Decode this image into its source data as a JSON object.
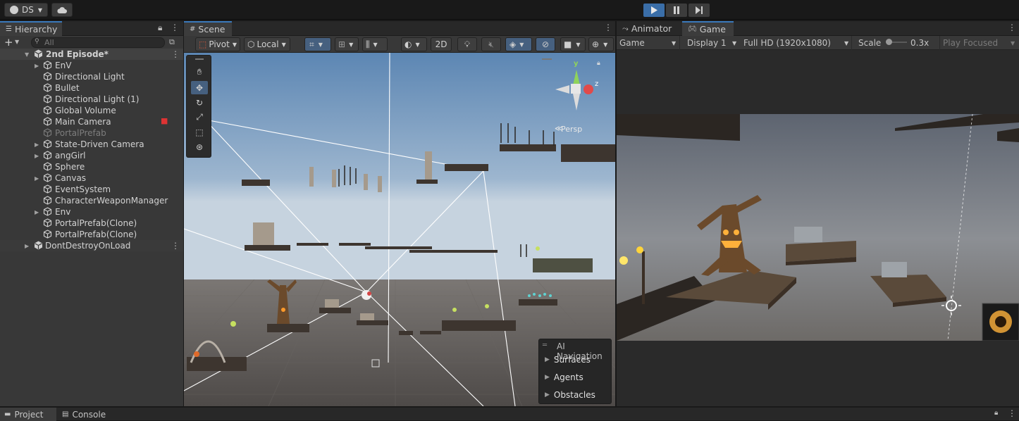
{
  "toolbar": {
    "account_label": "DS",
    "account_icon": "account-icon",
    "cloud_icon": "cloud-icon",
    "play_icon": "play-icon",
    "pause_icon": "pause-icon",
    "step_icon": "step-icon"
  },
  "hierarchy": {
    "tab_label": "Hierarchy",
    "search_placeholder": "All",
    "scene_name": "2nd Episode*",
    "items": [
      {
        "label": "EnV",
        "expandable": true,
        "dimmed": false
      },
      {
        "label": "Directional Light",
        "expandable": false,
        "dimmed": false
      },
      {
        "label": "Bullet",
        "expandable": false,
        "dimmed": false
      },
      {
        "label": "Directional Light (1)",
        "expandable": false,
        "dimmed": false
      },
      {
        "label": "Global Volume",
        "expandable": false,
        "dimmed": false
      },
      {
        "label": "Main Camera",
        "expandable": false,
        "dimmed": false
      },
      {
        "label": "PortalPrefab",
        "expandable": false,
        "dimmed": true
      },
      {
        "label": "State-Driven Camera",
        "expandable": true,
        "dimmed": false
      },
      {
        "label": "angGirl",
        "expandable": true,
        "dimmed": false
      },
      {
        "label": "Sphere",
        "expandable": false,
        "dimmed": false
      },
      {
        "label": "Canvas",
        "expandable": true,
        "dimmed": false
      },
      {
        "label": "EventSystem",
        "expandable": false,
        "dimmed": false
      },
      {
        "label": "CharacterWeaponManager",
        "expandable": false,
        "dimmed": false
      },
      {
        "label": "Env",
        "expandable": true,
        "dimmed": false
      },
      {
        "label": "PortalPrefab(Clone)",
        "expandable": false,
        "dimmed": false
      },
      {
        "label": "PortalPrefab(Clone)",
        "expandable": false,
        "dimmed": false
      }
    ],
    "dont_destroy": "DontDestroyOnLoad"
  },
  "scene": {
    "tab_label": "Scene",
    "pivot_label": "Pivot",
    "local_label": "Local",
    "mode_2d": "2D",
    "persp_label": "Persp",
    "gizmo_axes": {
      "x": "x",
      "y": "y",
      "z": "z"
    },
    "ai_nav": {
      "title": "AI Navigation",
      "items": [
        "Surfaces",
        "Agents",
        "Obstacles"
      ]
    }
  },
  "game": {
    "animator_tab": "Animator",
    "game_tab": "Game",
    "display_mode": "Game",
    "display": "Display 1",
    "resolution": "Full HD (1920x1080)",
    "scale_label": "Scale",
    "scale_value": "0.3x",
    "play_focused": "Play Focused"
  },
  "bottom": {
    "project_tab": "Project",
    "console_tab": "Console"
  },
  "colors": {
    "accent": "#3a79bb",
    "sky_top": "#5c86b3",
    "sky_horizon": "#c6d3df",
    "ground": "#5a5552"
  }
}
